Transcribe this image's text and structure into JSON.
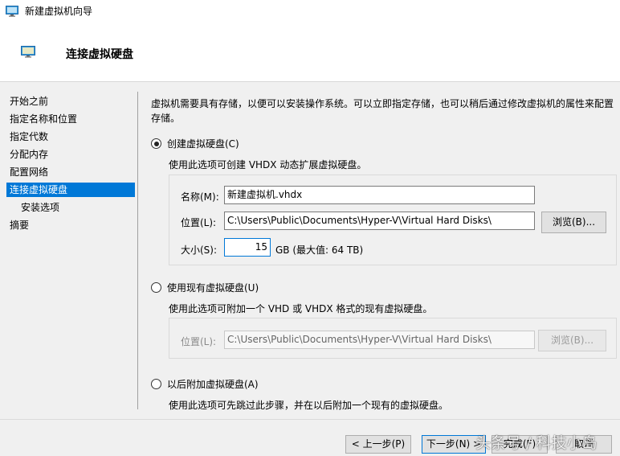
{
  "window": {
    "title": "新建虚拟机向导"
  },
  "header": {
    "title": "连接虚拟硬盘"
  },
  "sidebar": {
    "items": [
      {
        "label": "开始之前"
      },
      {
        "label": "指定名称和位置"
      },
      {
        "label": "指定代数"
      },
      {
        "label": "分配内存"
      },
      {
        "label": "配置网络"
      },
      {
        "label": "连接虚拟硬盘",
        "active": true
      },
      {
        "label": "安装选项"
      },
      {
        "label": "摘要"
      }
    ]
  },
  "content": {
    "description": "虚拟机需要具有存储，以便可以安装操作系统。可以立即指定存储，也可以稍后通过修改虚拟机的属性来配置存储。",
    "option_create": {
      "label": "创建虚拟硬盘(C)",
      "hint": "使用此选项可创建 VHDX 动态扩展虚拟硬盘。",
      "name_label": "名称(M):",
      "name_value": "新建虚拟机.vhdx",
      "location_label": "位置(L):",
      "location_value": "C:\\Users\\Public\\Documents\\Hyper-V\\Virtual Hard Disks\\",
      "browse_label": "浏览(B)...",
      "size_label": "大小(S):",
      "size_value": "15",
      "size_unit": "GB (最大值: 64 TB)"
    },
    "option_existing": {
      "label": "使用现有虚拟硬盘(U)",
      "hint": "使用此选项可附加一个 VHD 或 VHDX 格式的现有虚拟硬盘。",
      "location_label": "位置(L):",
      "location_value": "C:\\Users\\Public\\Documents\\Hyper-V\\Virtual Hard Disks\\",
      "browse_label": "浏览(B)..."
    },
    "option_later": {
      "label": "以后附加虚拟硬盘(A)",
      "hint": "使用此选项可先跳过此步骤，并在以后附加一个现有的虚拟硬盘。"
    }
  },
  "footer": {
    "prev_label": "< 上一步(P)",
    "next_label": "下一步(N) >",
    "finish_label": "完成(F)",
    "cancel_label": "取消",
    "watermark": "头条号 / 科技小岛"
  },
  "colors": {
    "accent": "#0078d7",
    "panel": "#f0f0f0"
  }
}
